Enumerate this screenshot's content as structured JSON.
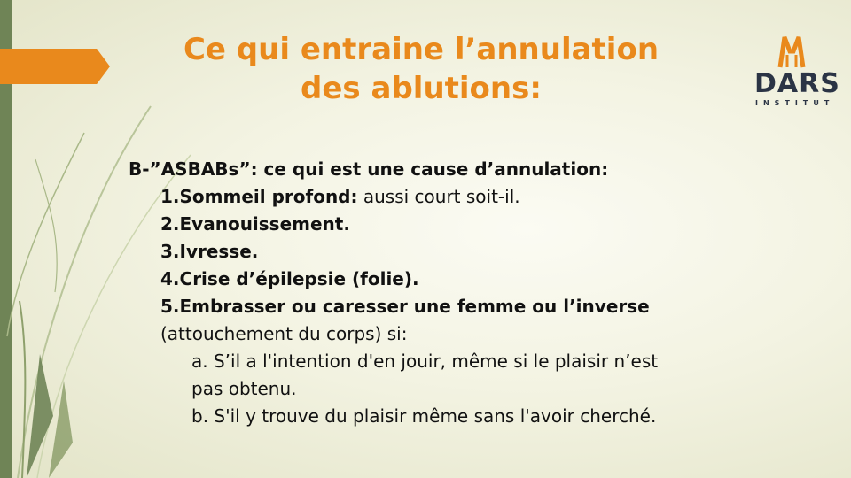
{
  "slide": {
    "title_line1": "Ce qui entraine l’annulation",
    "title_line2": "des ablutions:",
    "logo": {
      "word": "DARS",
      "sub": "INSTITUT"
    },
    "heading": "B-”ASBABs”: ce qui est une cause d’annulation:",
    "items": [
      {
        "bold": "1.Sommeil profond:",
        "rest": " aussi court soit-il."
      },
      {
        "bold": "2.Evanouissement.",
        "rest": ""
      },
      {
        "bold": "3.Ivresse.",
        "rest": ""
      },
      {
        "bold": "4.Crise d’épilepsie (folie).",
        "rest": ""
      },
      {
        "bold": "5.Embrasser ou caresser une femme ou l’inverse",
        "rest": ""
      }
    ],
    "item5_cont": "(attouchement du corps) si:",
    "sub_a_line1": "a. S’il a l'intention d'en jouir, même si le plaisir n’est",
    "sub_a_line2": "pas obtenu.",
    "sub_b": "b. S'il y trouve du plaisir même sans l'avoir cherché."
  },
  "colors": {
    "accent": "#e9891c",
    "bar": "#6f8456",
    "logo_text": "#2b3445"
  }
}
